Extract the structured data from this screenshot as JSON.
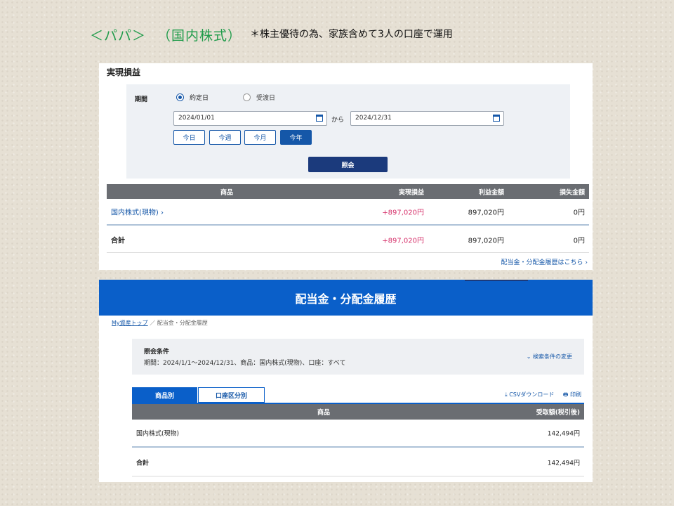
{
  "slide": {
    "title_left": "＜パパ＞",
    "title_paren": "（国内株式）",
    "note": "＊株主優待の為、家族含めて3人の口座で運用"
  },
  "realized": {
    "title": "実現損益",
    "period_label": "期間",
    "radio_trade": "約定日",
    "radio_settle": "受渡日",
    "date_from": "2024/01/01",
    "date_to": "2024/12/31",
    "kara": "から",
    "quick": [
      "今日",
      "今週",
      "今月",
      "今年"
    ],
    "search_button": "照会",
    "columns": [
      "商品",
      "実現損益",
      "利益金額",
      "損失金額"
    ],
    "rows": [
      {
        "name": "国内株式(現物) ›",
        "realized": "+897,020円",
        "profit": "897,020円",
        "loss": "0円"
      },
      {
        "name": "合計",
        "realized": "+897,020円",
        "profit": "897,020円",
        "loss": "0円"
      }
    ],
    "dividend_link": "配当金・分配金履歴はこちら ›"
  },
  "dividend": {
    "banner": "配当金・分配金履歴",
    "crumb_home": "My資産トップ",
    "crumb_sep": "／",
    "crumb_current": "配当金・分配金履歴",
    "cond_title": "照会条件",
    "cond_text": "期間：2024/1/1〜2024/12/31、商品：国内株式(現物)、口座：すべて",
    "cond_change": "⌄ 検索条件の変更",
    "tabs": [
      "商品別",
      "口座区分別"
    ],
    "csv": "⤓ CSVダウンロード",
    "print": "🖶 印刷",
    "columns": [
      "商品",
      "受取額(税引後)"
    ],
    "rows": [
      {
        "name": "国内株式(現物)",
        "amount": "142,494円"
      },
      {
        "name": "合計",
        "amount": "142,494円"
      }
    ]
  },
  "colors": {
    "accent_blue": "#0a5fc9",
    "navy": "#1b3a7c",
    "positive": "#d6336c",
    "title_green": "#1f9b4a"
  }
}
